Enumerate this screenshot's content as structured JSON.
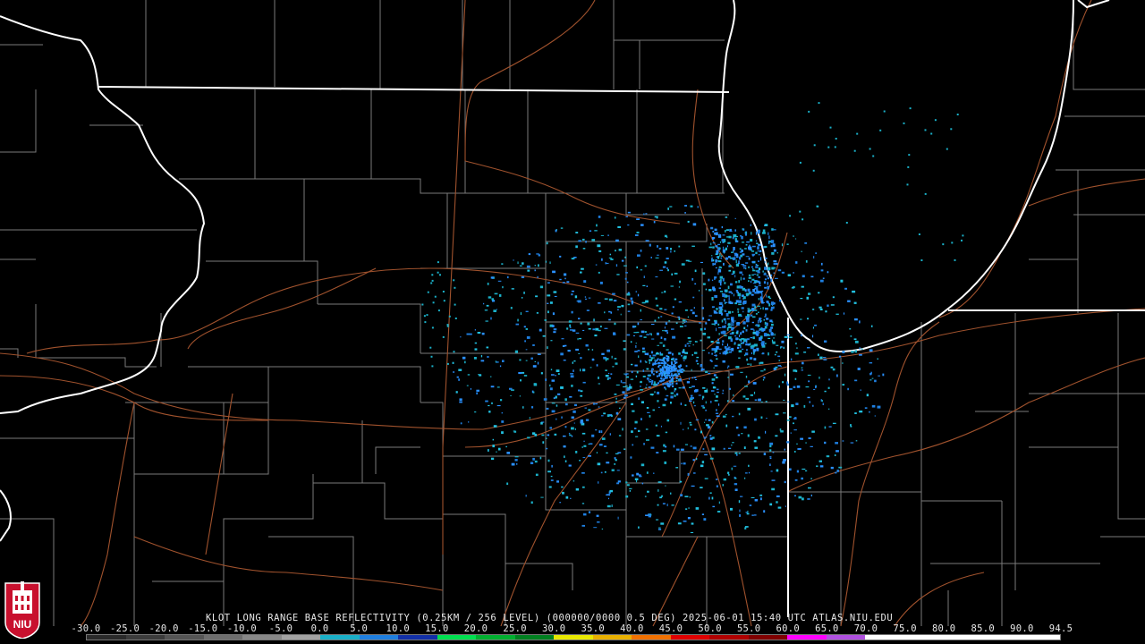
{
  "product": {
    "caption": "KLOT LONG RANGE BASE REFLECTIVITY (0.25KM / 256 LEVEL) (000000/0000 0.5 DEG) 2025-06-01 15:40 UTC  ATLAS.NIU.EDU"
  },
  "legend": {
    "ticks": [
      "-30.0",
      "-25.0",
      "-20.0",
      "-15.0",
      "-10.0",
      "-5.0",
      "0.0",
      "5.0",
      "10.0",
      "15.0",
      "20.0",
      "25.0",
      "30.0",
      "35.0",
      "40.0",
      "45.0",
      "50.0",
      "55.0",
      "60.0",
      "65.0",
      "70.0",
      "75.0",
      "80.0",
      "85.0",
      "90.0",
      "94.5"
    ],
    "colors": [
      "#2a2a2a",
      "#3c3c3c",
      "#555555",
      "#6e6e6e",
      "#888888",
      "#a3a3a3",
      "#1ab0c8",
      "#1f7fe0",
      "#1230a8",
      "#00e050",
      "#00b030",
      "#008020",
      "#e8e800",
      "#e8b000",
      "#f07000",
      "#e00000",
      "#b00000",
      "#800000",
      "#ff00ff",
      "#b050e0",
      "#ffffff",
      "#ffffff",
      "#ffffff",
      "#ffffff",
      "#ffffff"
    ]
  },
  "logo": {
    "text": "NIU"
  },
  "icons": {
    "logo": "niu-logo-icon",
    "map": "radar-map"
  }
}
